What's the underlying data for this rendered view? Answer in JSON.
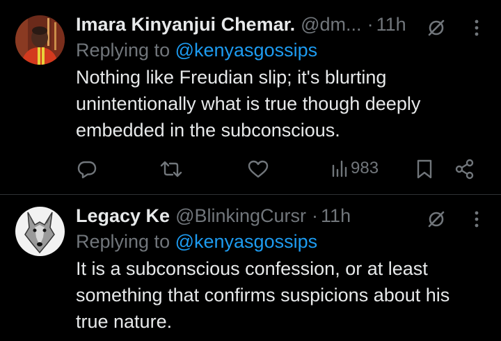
{
  "replies": [
    {
      "display_name": "Imara Kinyanjui Chemar.",
      "handle": "@dm",
      "handle_ellipsis": "...",
      "separator": "·",
      "time": "11h",
      "replying_prefix": "Replying to ",
      "replying_to": "@kenyasgossips",
      "text_lines": [
        "Nothing like  Freudian slip; it's  blurting",
        "unintentionally what is true though  deeply",
        "embedded in the subconscious."
      ],
      "views": "983",
      "avatar_icon": "person-photo-avatar"
    },
    {
      "display_name": "Legacy Ke",
      "handle": "@BlinkingCursr",
      "separator": "·",
      "time": "11h",
      "replying_prefix": "Replying to ",
      "replying_to": "@kenyasgossips",
      "text_lines": [
        "It is a subconscious confession, or at least",
        "something that confirms suspicions about his",
        "true nature."
      ],
      "avatar_icon": "wolf-avatar"
    }
  ],
  "icons": {
    "grok": "grok-icon",
    "more": "more-icon",
    "reply": "reply-icon",
    "repost": "repost-icon",
    "like": "like-icon",
    "views": "views-icon",
    "bookmark": "bookmark-icon",
    "share": "share-icon"
  },
  "colors": {
    "background": "#000000",
    "primary_text": "#e7e9ea",
    "secondary_text": "#71767b",
    "link": "#1d9bf0",
    "divider": "#2f3336"
  }
}
